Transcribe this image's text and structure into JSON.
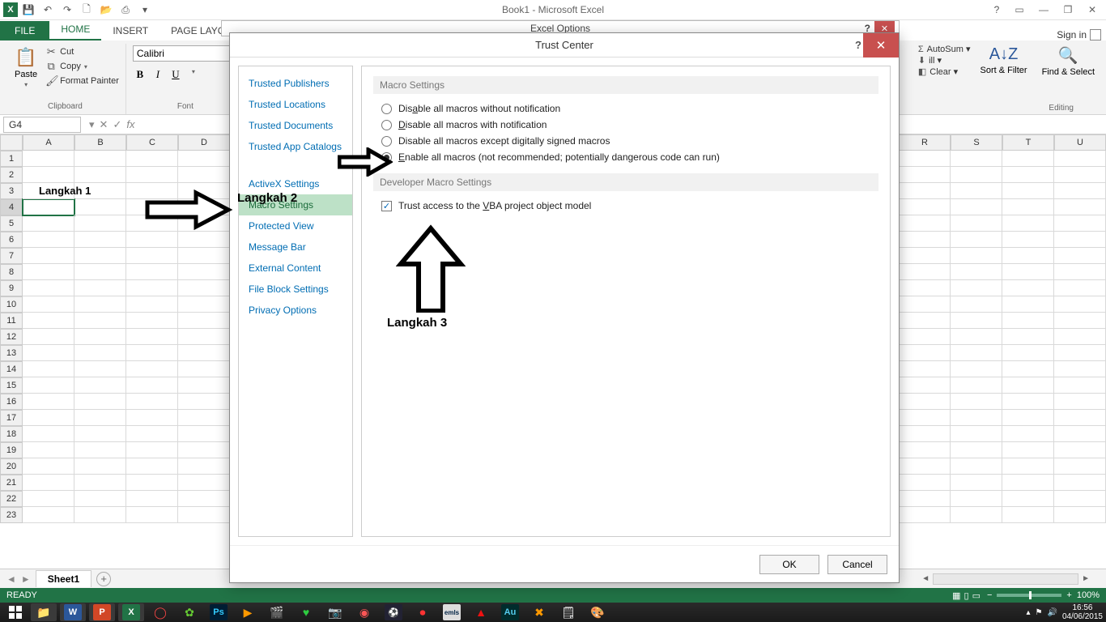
{
  "app": {
    "title": "Book1 - Microsoft Excel",
    "signin": "Sign in"
  },
  "tabs": {
    "file": "FILE",
    "home": "HOME",
    "insert": "INSERT",
    "pagelayout": "PAGE LAYOUT"
  },
  "ribbon": {
    "clipboard": {
      "paste": "Paste",
      "cut": "Cut",
      "copy": "Copy",
      "painter": "Format Painter",
      "group": "Clipboard"
    },
    "font": {
      "name": "Calibri",
      "group": "Font"
    },
    "right": {
      "autosum": "AutoSum",
      "fill": "ill",
      "clear": "Clear",
      "sort": "Sort & Filter",
      "find": "Find & Select",
      "group": "Editing"
    }
  },
  "namebox": "G4",
  "cols_left": [
    "A",
    "B",
    "C",
    "D"
  ],
  "cols_right": [
    "R",
    "S",
    "T",
    "U"
  ],
  "rows": [
    "1",
    "2",
    "3",
    "4",
    "5",
    "6",
    "7",
    "8",
    "9",
    "10",
    "11",
    "12",
    "13",
    "14",
    "15",
    "16",
    "17",
    "18",
    "19",
    "20",
    "21",
    "22",
    "23"
  ],
  "cell_text": "Langkah 1",
  "sheet_tab": "Sheet1",
  "status": {
    "ready": "READY",
    "zoom": "100%"
  },
  "excel_options_title": "Excel Options",
  "dialog": {
    "title": "Trust Center",
    "nav": [
      "Trusted Publishers",
      "Trusted Locations",
      "Trusted Documents",
      "Trusted App Catalogs",
      "ActiveX Settings",
      "Macro Settings",
      "Protected View",
      "Message Bar",
      "External Content",
      "File Block Settings",
      "Privacy Options"
    ],
    "section1": "Macro Settings",
    "radios": [
      "Disable all macros without notification",
      "Disable all macros with notification",
      "Disable all macros except digitally signed macros",
      "Enable all macros (not recommended; potentially dangerous code can run)"
    ],
    "section2": "Developer Macro Settings",
    "check": "Trust access to the VBA project object model",
    "ok": "OK",
    "cancel": "Cancel"
  },
  "steps": {
    "s2": "Langkah 2",
    "s3": "Langkah 3"
  },
  "taskbar": {
    "time": "16:56",
    "date": "04/06/2015"
  }
}
